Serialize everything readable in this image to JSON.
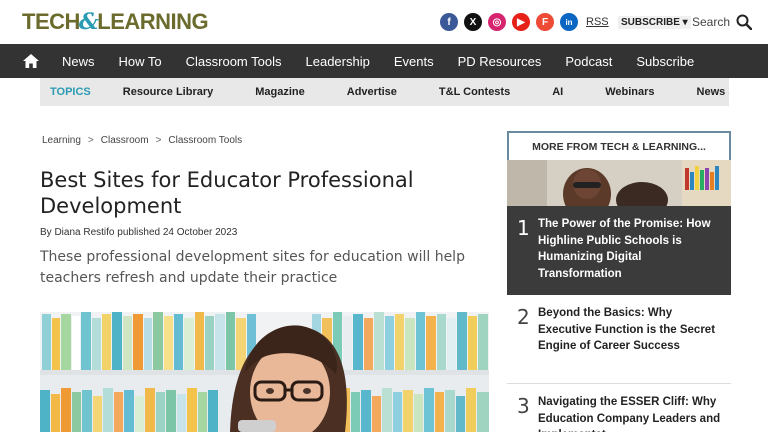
{
  "header": {
    "logo_left": "TECH",
    "logo_amp": "&",
    "logo_right": "LEARNING",
    "social": {
      "facebook": "f",
      "x": "X",
      "instagram": "◎",
      "youtube": "▶",
      "flipboard": "F",
      "linkedin": "in",
      "rss": "RSS"
    },
    "subscribe_label": "SUBSCRIBE ▾",
    "search_label": "Search"
  },
  "nav": {
    "items": [
      "News",
      "How To",
      "Classroom Tools",
      "Leadership",
      "Events",
      "PD Resources",
      "Podcast",
      "Subscribe"
    ]
  },
  "topics": {
    "label": "TOPICS",
    "items": [
      "Resource Library",
      "Magazine",
      "Advertise",
      "T&L Contests",
      "AI",
      "Webinars",
      "News Sig"
    ]
  },
  "breadcrumb": [
    "Learning",
    "Classroom",
    "Classroom Tools"
  ],
  "breadcrumb_sep": ">",
  "article": {
    "title": "Best Sites for Educator Professional Development",
    "byline_prefix": "By",
    "author": "Diana Restifo",
    "published_label": "published",
    "date": "24 October 2023",
    "standfirst": "These professional development sites for education will help teachers refresh and update their practice"
  },
  "sidebar": {
    "header": "MORE FROM TECH & LEARNING...",
    "items": [
      {
        "num": "1",
        "title": "The Power of the Promise: How Highline Public Schools is Humanizing Digital Transformation"
      },
      {
        "num": "2",
        "title": "Beyond the Basics: Why Executive Function is the Secret Engine of Career Success"
      },
      {
        "num": "3",
        "title": "Navigating the ESSER Cliff: Why Education Company Leaders and Implementat..."
      }
    ]
  },
  "colors": {
    "nav_bg": "#333333",
    "accent": "#2a9bb3",
    "logo": "#6b6b2e"
  }
}
